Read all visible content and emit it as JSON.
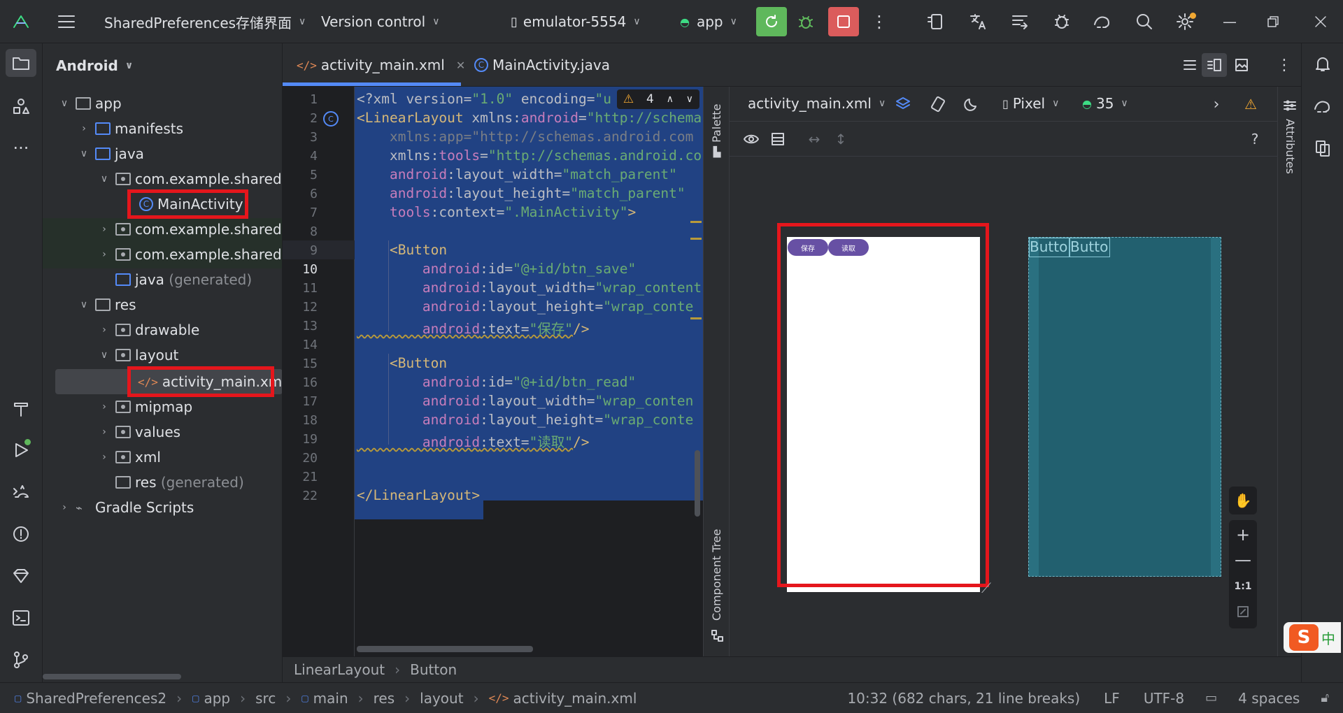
{
  "titlebar": {
    "project": "SharedPreferences存储界面",
    "vcs": "Version control",
    "device": "emulator-5554",
    "run_config": "app"
  },
  "project_panel": {
    "title": "Android",
    "tree": {
      "app": "app",
      "manifests": "manifests",
      "java": "java",
      "pkg1": "com.example.sharedpr",
      "main_activity": "MainActivity",
      "pkg2": "com.example.sharedpr",
      "pkg3": "com.example.sharedpr",
      "java_generated": "java",
      "generated_suffix": "(generated)",
      "res": "res",
      "drawable": "drawable",
      "layout": "layout",
      "activity_main": "activity_main.xml",
      "mipmap": "mipmap",
      "values": "values",
      "xml": "xml",
      "res_generated": "res",
      "gradle": "Gradle Scripts"
    }
  },
  "tabs": [
    {
      "label": "activity_main.xml",
      "active": true
    },
    {
      "label": "MainActivity.java",
      "active": false
    }
  ],
  "editor": {
    "line_numbers": [
      "1",
      "2",
      "3",
      "4",
      "5",
      "6",
      "7",
      "8",
      "9",
      "10",
      "11",
      "12",
      "13",
      "14",
      "15",
      "16",
      "17",
      "18",
      "19",
      "20",
      "21",
      "22"
    ],
    "current_line": "10",
    "warnings_count": "4",
    "lines": {
      "l1a": "<?xml version=",
      "l1b": "\"1.0\"",
      "l1c": " encoding=",
      "l1d": "\"u",
      "l2a": "<LinearLayout ",
      "l2b": "xmlns:",
      "l2c": "android",
      "l2d": "=",
      "l2e": "\"http://schema",
      "l3": "    xmlns:app=\"http://schemas.android.com",
      "l4a": "    xmlns:",
      "l4b": "tools",
      "l4c": "=",
      "l4d": "\"http://schemas.android.co",
      "l5a": "    android",
      "l5b": ":layout_width=",
      "l5c": "\"match_parent\"",
      "l6a": "    android",
      "l6b": ":layout_height=",
      "l6c": "\"match_parent\"",
      "l7a": "    tools",
      "l7b": ":context=",
      "l7c": "\".MainActivity\"",
      "l7d": ">",
      "l9": "    <Button",
      "l10a": "        android",
      "l10b": ":id=",
      "l10c": "\"@+id/btn_save\"",
      "l11a": "        android",
      "l11b": ":layout_width=",
      "l11c": "\"wrap_content",
      "l12a": "        android",
      "l12b": ":layout_height=",
      "l12c": "\"wrap_conte",
      "l13a": "        android",
      "l13b": ":text=",
      "l13c": "\"保存\"",
      "l13d": "/>",
      "l15": "    <Button",
      "l16a": "        android",
      "l16b": ":id=",
      "l16c": "\"@+id/btn_read\"",
      "l17a": "        android",
      "l17b": ":layout_width=",
      "l17c": "\"wrap_conten",
      "l18a": "        android",
      "l18b": ":layout_height=",
      "l18c": "\"wrap_conte",
      "l19a": "        android",
      "l19b": ":text=",
      "l19c": "\"读取\"",
      "l19d": "/>",
      "l22": "</LinearLayout>"
    }
  },
  "side_tabs": {
    "palette": "Palette",
    "component_tree": "Component Tree",
    "attributes": "Attributes"
  },
  "design": {
    "file": "activity_main.xml",
    "device": "Pixel",
    "api": "35",
    "zoom_label": "1:1",
    "help": "?",
    "preview_buttons": [
      "保存",
      "读取"
    ],
    "blueprint_buttons": [
      "Button",
      "Button"
    ]
  },
  "breadcrumb": [
    "LinearLayout",
    "Button"
  ],
  "statusbar": {
    "path": [
      "SharedPreferences2",
      "app",
      "src",
      "main",
      "res",
      "layout",
      "activity_main.xml"
    ],
    "position": "10:32 (682 chars, 21 line breaks)",
    "line_sep": "LF",
    "encoding": "UTF-8",
    "indent": "4 spaces"
  },
  "ime": {
    "label": "中"
  },
  "colors": {
    "accent": "#548af7",
    "run_green": "#5fb85c",
    "stop_red": "#db5c5c",
    "highlight": "#e5161c",
    "selection": "#214283"
  }
}
